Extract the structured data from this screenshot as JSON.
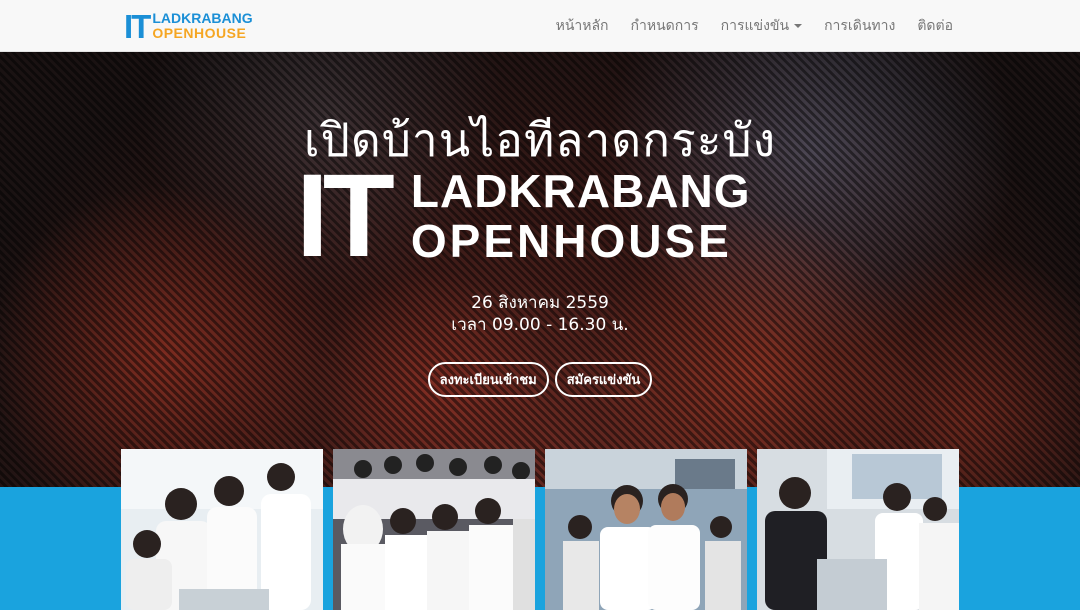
{
  "brand": {
    "it": "IT",
    "line1": "LADKRABANG",
    "line2": "OPENHOUSE"
  },
  "nav": {
    "items": [
      {
        "label": "หน้าหลัก"
      },
      {
        "label": "กำหนดการ"
      },
      {
        "label": "การแข่งขัน",
        "has_dropdown": true
      },
      {
        "label": "การเดินทาง"
      },
      {
        "label": "ติดต่อ"
      }
    ]
  },
  "hero": {
    "title_th": "เปิดบ้านไอทีลาดกระบัง",
    "logo_it": "IT",
    "logo_line1": "LADKRABANG",
    "logo_line2": "OPENHOUSE",
    "date": "26 สิงหาคม 2559",
    "time": "เวลา 09.00 - 16.30 น.",
    "register_button": "ลงทะเบียนเข้าชม",
    "compete_button": "สมัครแข่งขัน"
  },
  "photos": [
    {
      "icon": "students-photo-1"
    },
    {
      "icon": "students-photo-2"
    },
    {
      "icon": "students-photo-3"
    },
    {
      "icon": "students-photo-4"
    }
  ],
  "colors": {
    "brand_blue": "#1b8fd6",
    "brand_orange": "#f5a623",
    "band_blue": "#1aa3de",
    "nav_text": "#777777"
  }
}
